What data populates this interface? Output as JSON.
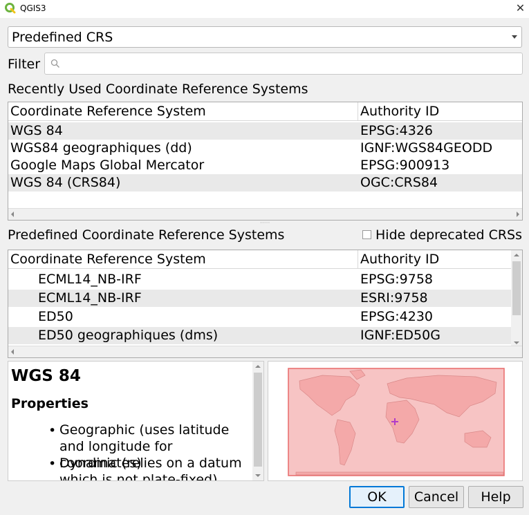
{
  "window": {
    "title": "QGIS3",
    "close_glyph": "✕"
  },
  "mode_combo": {
    "value": "Predefined CRS"
  },
  "filter": {
    "label": "Filter",
    "value": "",
    "placeholder": ""
  },
  "recent": {
    "heading": "Recently Used Coordinate Reference Systems",
    "columns": [
      "Coordinate Reference System",
      "Authority ID"
    ],
    "rows": [
      {
        "name": "WGS 84",
        "auth": "EPSG:4326"
      },
      {
        "name": "WGS84 geographiques (dd)",
        "auth": "IGNF:WGS84GEODD"
      },
      {
        "name": "Google Maps Global Mercator",
        "auth": "EPSG:900913"
      },
      {
        "name": "WGS 84 (CRS84)",
        "auth": "OGC:CRS84"
      }
    ]
  },
  "predefined": {
    "heading": "Predefined Coordinate Reference Systems",
    "hide_deprecated_label": "Hide deprecated CRSs",
    "hide_deprecated_checked": false,
    "columns": [
      "Coordinate Reference System",
      "Authority ID"
    ],
    "rows": [
      {
        "name": "ECML14_NB-IRF",
        "auth": "EPSG:9758"
      },
      {
        "name": "ECML14_NB-IRF",
        "auth": "ESRI:9758"
      },
      {
        "name": "ED50",
        "auth": "EPSG:4230"
      },
      {
        "name": "ED50 geographiques (dms)",
        "auth": "IGNF:ED50G"
      }
    ]
  },
  "info": {
    "title": "WGS 84",
    "properties_heading": "Properties",
    "bullets": [
      "Geographic (uses latitude and longitude for coordinates)",
      "Dynamic (relies on a datum which is not plate-fixed)"
    ]
  },
  "buttons": {
    "ok": "OK",
    "cancel": "Cancel",
    "help": "Help"
  },
  "colors": {
    "extent_fill": "#f4b3b3",
    "extent_border": "#e86a6a",
    "marker": "#b03cc8",
    "ok_border": "#0078d7"
  },
  "icons": {
    "app": "qgis-icon",
    "search": "search-icon",
    "close": "close-icon"
  }
}
